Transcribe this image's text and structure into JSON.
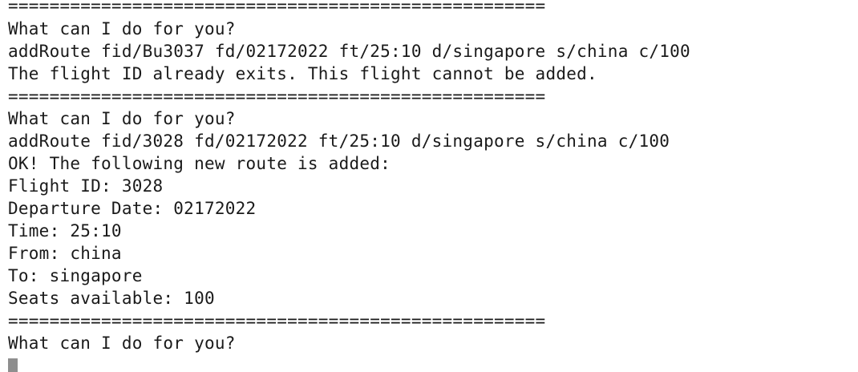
{
  "terminal": {
    "lines": [
      {
        "kind": "separator",
        "text": "===================================================="
      },
      {
        "kind": "prompt",
        "text": "What can I do for you?"
      },
      {
        "kind": "command",
        "text": "addRoute fid/Bu3037 fd/02172022 ft/25:10 d/singapore s/china c/100"
      },
      {
        "kind": "output",
        "text": "The flight ID already exits. This flight cannot be added."
      },
      {
        "kind": "separator",
        "text": "===================================================="
      },
      {
        "kind": "prompt",
        "text": "What can I do for you?"
      },
      {
        "kind": "command",
        "text": "addRoute fid/3028 fd/02172022 ft/25:10 d/singapore s/china c/100"
      },
      {
        "kind": "output",
        "text": "OK! The following new route is added:"
      },
      {
        "kind": "output",
        "text": "Flight ID: 3028"
      },
      {
        "kind": "output",
        "text": "Departure Date: 02172022"
      },
      {
        "kind": "output",
        "text": "Time: 25:10"
      },
      {
        "kind": "output",
        "text": "From: china"
      },
      {
        "kind": "output",
        "text": "To: singapore"
      },
      {
        "kind": "output",
        "text": "Seats available: 100"
      },
      {
        "kind": "separator",
        "text": "===================================================="
      },
      {
        "kind": "prompt",
        "text": "What can I do for you?"
      }
    ],
    "cursor_color": "#8e8e8e",
    "text_color": "#1a1a1a",
    "background_color": "#ffffff"
  }
}
